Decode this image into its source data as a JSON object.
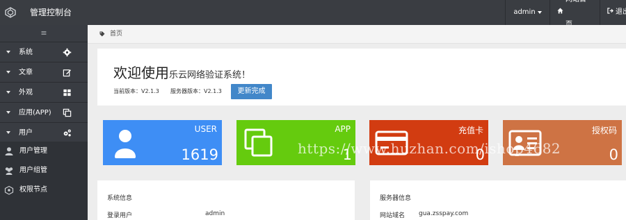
{
  "topbar": {
    "brand": "管理控制台",
    "user": "admin",
    "site_home": "网站首页",
    "logout": "退出"
  },
  "sidebar": {
    "toggle_icon": "menu-bars-icon",
    "groups": [
      {
        "label": "系统",
        "icon": "gear-icon"
      },
      {
        "label": "文章",
        "icon": "edit-icon"
      },
      {
        "label": "外观",
        "icon": "grid-icon"
      },
      {
        "label": "应用(APP)",
        "icon": "copy-icon"
      },
      {
        "label": "用户",
        "icon": "gears-icon"
      }
    ],
    "subitems": [
      {
        "label": "用户管理",
        "icon": "user-icon"
      },
      {
        "label": "用户组管",
        "icon": "users-icon"
      },
      {
        "label": "权限节点",
        "icon": "nodes-icon"
      }
    ]
  },
  "breadcrumb": {
    "home": "首页"
  },
  "welcome": {
    "title_big": "欢迎使用",
    "title_small": "乐云网络验证系统！",
    "current_version": "当前版本：V2.1.3",
    "server_version": "服务器版本：V2.1.3",
    "update_button": "更新完成"
  },
  "cards": [
    {
      "title": "USER",
      "value": "1619",
      "color": "#3e8ef5",
      "icon": "user-icon"
    },
    {
      "title": "APP",
      "value": "1",
      "color": "#65cb0e",
      "icon": "copy-icon"
    },
    {
      "title": "充值卡",
      "value": "0",
      "color": "#d23c11",
      "icon": "credit-card-icon"
    },
    {
      "title": "授权码",
      "value": "0",
      "color": "#ce7344",
      "icon": "id-card-icon"
    }
  ],
  "panels": {
    "system": {
      "title": "系统信息",
      "row_label": "登录用户",
      "row_value": "admin"
    },
    "server": {
      "title": "服务器信息",
      "row_label": "网站域名",
      "row_value": "gua.zsspay.com"
    }
  },
  "watermark": "https://www.huzhan.com/ishop4682"
}
